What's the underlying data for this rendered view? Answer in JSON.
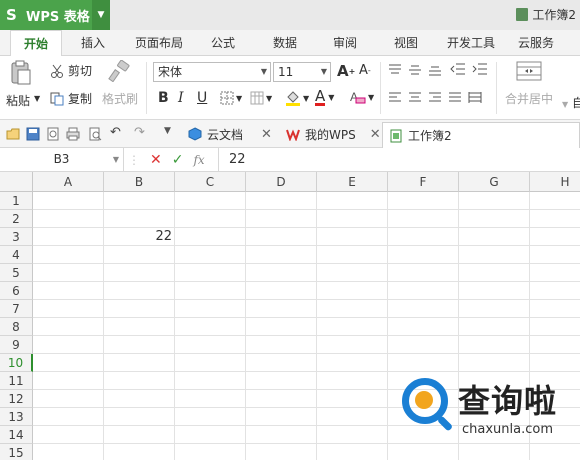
{
  "app": {
    "name": "WPS 表格",
    "logo_letter": "S",
    "doc_title": "工作簿2"
  },
  "menu_tabs": [
    "开始",
    "插入",
    "页面布局",
    "公式",
    "数据",
    "审阅",
    "视图",
    "开发工具",
    "云服务"
  ],
  "ribbon": {
    "paste": "粘贴",
    "cut": "剪切",
    "copy": "复制",
    "format_painter": "格式刷",
    "font_name": "宋体",
    "font_size": "11",
    "bold": "B",
    "italic": "I",
    "underline": "U",
    "merge_center": "合并居中",
    "auto_wrap_partial": "自"
  },
  "doc_tabs": {
    "cloud": "云文档",
    "mywps": "我的WPS",
    "workbook": "工作簿2"
  },
  "formula_bar": {
    "cell_ref": "B3",
    "fx_label": "fx",
    "value": "22"
  },
  "sheet": {
    "columns": [
      "A",
      "B",
      "C",
      "D",
      "E",
      "F",
      "G",
      "H"
    ],
    "rows": [
      "1",
      "2",
      "3",
      "4",
      "5",
      "6",
      "7",
      "8",
      "9",
      "10",
      "11",
      "12",
      "13",
      "14",
      "15"
    ],
    "active_row": "10",
    "cells": {
      "B3": "22"
    }
  },
  "watermark": {
    "cn": "查询啦",
    "en": "chaxunla.com"
  },
  "colors": {
    "accent": "#4ba34b",
    "active_tab_text": "#2d7f2d",
    "watermark_blue": "#1a7fd4",
    "watermark_orange": "#f2a51e"
  }
}
